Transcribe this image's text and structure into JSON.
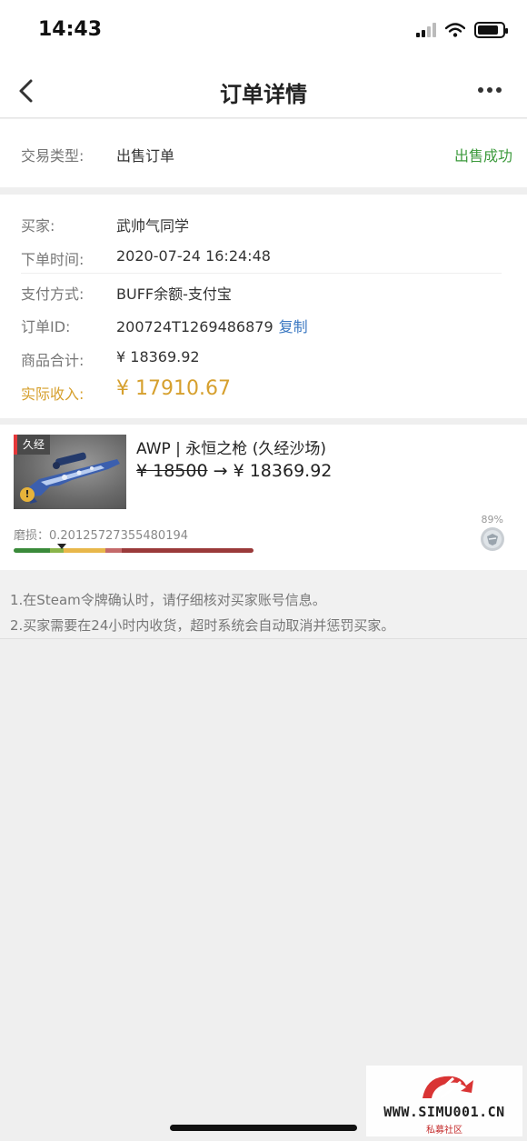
{
  "status_bar": {
    "time": "14:43"
  },
  "nav": {
    "title": "订单详情"
  },
  "order_type": {
    "label": "交易类型:",
    "value": "出售订单",
    "status": "出售成功"
  },
  "details": [
    {
      "label": "买家:",
      "value": "武帅气同学"
    },
    {
      "label": "下单时间:",
      "value": "2020-07-24 16:24:48"
    },
    {
      "label": "支付方式:",
      "value": "BUFF余额-支付宝"
    },
    {
      "label": "订单ID:",
      "value": "200724T1269486879",
      "action": "复制"
    },
    {
      "label": "商品合计:",
      "value": "¥ 18369.92"
    },
    {
      "label": "实际收入:",
      "value": "¥ 17910.67"
    }
  ],
  "item": {
    "wear_tag": "久经",
    "warning_icon": "!",
    "name": "AWP | 永恒之枪 (久经沙场)",
    "old_price": "¥ 18500",
    "arrow": "→",
    "new_price": "¥ 18369.92",
    "wear_label": "磨损：0.20125727355480194",
    "wear_value": 0.20125727355480194,
    "percent": "89%"
  },
  "notes": [
    "1.在Steam令牌确认时，请仔细核对买家账号信息。",
    "2.买家需要在24小时内收货，超时系统会自动取消并惩罚买家。"
  ],
  "watermark": {
    "text": "WWW.SIMU001.CN",
    "sub": "私募社区"
  },
  "colors": {
    "success_green": "#3c9a3c",
    "income_gold": "#d6a02e",
    "link_blue": "#3b78c2",
    "wear_fn": "#3a8a3a",
    "wear_mw": "#8ab44a",
    "wear_ft": "#e8b74a",
    "wear_ww": "#c46a6a",
    "wear_bs": "#9a3a3a"
  },
  "icons": {
    "back": "chevron-left-icon",
    "more": "more-dots-icon",
    "signal": "signal-icon",
    "wifi": "wifi-icon",
    "battery": "battery-icon",
    "warning": "warning-icon",
    "badge": "shield-badge-icon"
  }
}
